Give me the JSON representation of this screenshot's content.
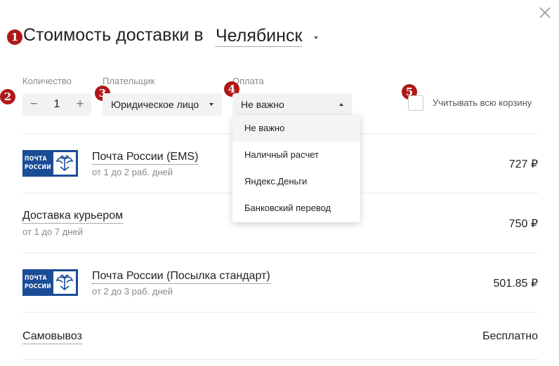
{
  "header": {
    "title_prefix": "Стоимость доставки в",
    "city": "Челябинск",
    "close_icon": "close-icon"
  },
  "annotations": {
    "badge_1": "1",
    "badge_2": "2",
    "badge_3": "3",
    "badge_4": "4",
    "badge_5": "5",
    "color": "#b01818"
  },
  "filters": {
    "quantity": {
      "label": "Количество",
      "value": "1",
      "minus": "−",
      "plus": "+"
    },
    "payer": {
      "label": "Плательщик",
      "value": "Юридическое лицо"
    },
    "payment": {
      "label": "Оплата",
      "value": "Не важно",
      "options": [
        "Не важно",
        "Наличный расчет",
        "Яндекс.Деньги",
        "Банковский перевод"
      ]
    },
    "whole_cart": {
      "label": "Учитывать всю корзину",
      "checked": false
    }
  },
  "deliveries": [
    {
      "name": "Почта России (EMS)",
      "subtitle": "от 1 до 2 раб. дней",
      "price": "727 ₽",
      "logo_text": "ПОЧТА РОССИИ"
    },
    {
      "name": "Доставка курьером",
      "subtitle": "от 1 до 7 дней",
      "price": "750 ₽"
    },
    {
      "name": "Почта России (Посылка стандарт)",
      "subtitle": "от 2 до 3 раб. дней",
      "price": "501.85 ₽",
      "logo_text": "ПОЧТА РОССИИ"
    },
    {
      "name": "Самовывоз",
      "price": "Бесплатно"
    }
  ],
  "colors": {
    "logo_blue": "#1b4c96",
    "control_bg": "#f2f2f2"
  }
}
